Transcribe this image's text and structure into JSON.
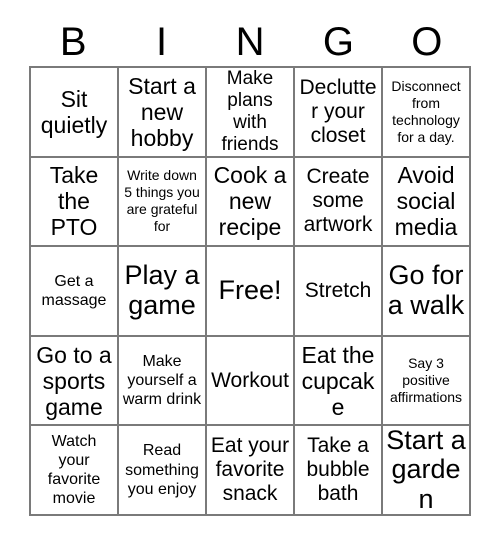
{
  "card": {
    "title": "BINGO",
    "header_letters": [
      "B",
      "I",
      "N",
      "G",
      "O"
    ],
    "border_color": "#7a7a7a",
    "background_color": "#ffffff",
    "text_color": "#000000",
    "columns": 5,
    "rows": 5,
    "free_space_index": 12
  },
  "cells": [
    {
      "text": "Sit quietly",
      "size": "xl",
      "row": 1,
      "col": "B"
    },
    {
      "text": "Start a new hobby",
      "size": "xl",
      "row": 1,
      "col": "I"
    },
    {
      "text": "Make plans with friends",
      "size": "md",
      "row": 1,
      "col": "N"
    },
    {
      "text": "Declutter your closet",
      "size": "lg",
      "row": 1,
      "col": "G"
    },
    {
      "text": "Disconnect from technology for a day.",
      "size": "xs",
      "row": 1,
      "col": "O"
    },
    {
      "text": "Take the PTO",
      "size": "xl",
      "row": 2,
      "col": "B"
    },
    {
      "text": "Write down 5 things you are grateful for",
      "size": "xs",
      "row": 2,
      "col": "I"
    },
    {
      "text": "Cook a new recipe",
      "size": "xl",
      "row": 2,
      "col": "N"
    },
    {
      "text": "Create some artwork",
      "size": "lg",
      "row": 2,
      "col": "G"
    },
    {
      "text": "Avoid social media",
      "size": "xl",
      "row": 2,
      "col": "O"
    },
    {
      "text": "Get a massage",
      "size": "sm",
      "row": 3,
      "col": "B"
    },
    {
      "text": "Play a game",
      "size": "xxl",
      "row": 3,
      "col": "I"
    },
    {
      "text": "Free!",
      "size": "xxl",
      "row": 3,
      "col": "N"
    },
    {
      "text": "Stretch",
      "size": "lg",
      "row": 3,
      "col": "G"
    },
    {
      "text": "Go for a walk",
      "size": "xxl",
      "row": 3,
      "col": "O"
    },
    {
      "text": "Go to a sports game",
      "size": "xl",
      "row": 4,
      "col": "B"
    },
    {
      "text": "Make yourself a warm drink",
      "size": "sm",
      "row": 4,
      "col": "I"
    },
    {
      "text": "Workout",
      "size": "lg",
      "row": 4,
      "col": "N"
    },
    {
      "text": "Eat the cupcake",
      "size": "xl",
      "row": 4,
      "col": "G"
    },
    {
      "text": "Say 3 positive affirmations",
      "size": "xs",
      "row": 4,
      "col": "O"
    },
    {
      "text": "Watch your favorite movie",
      "size": "sm",
      "row": 5,
      "col": "B"
    },
    {
      "text": "Read something you enjoy",
      "size": "sm",
      "row": 5,
      "col": "I"
    },
    {
      "text": "Eat your favorite snack",
      "size": "lg",
      "row": 5,
      "col": "N"
    },
    {
      "text": "Take a bubble bath",
      "size": "lg",
      "row": 5,
      "col": "G"
    },
    {
      "text": "Start a garden",
      "size": "xxl",
      "row": 5,
      "col": "O"
    }
  ]
}
